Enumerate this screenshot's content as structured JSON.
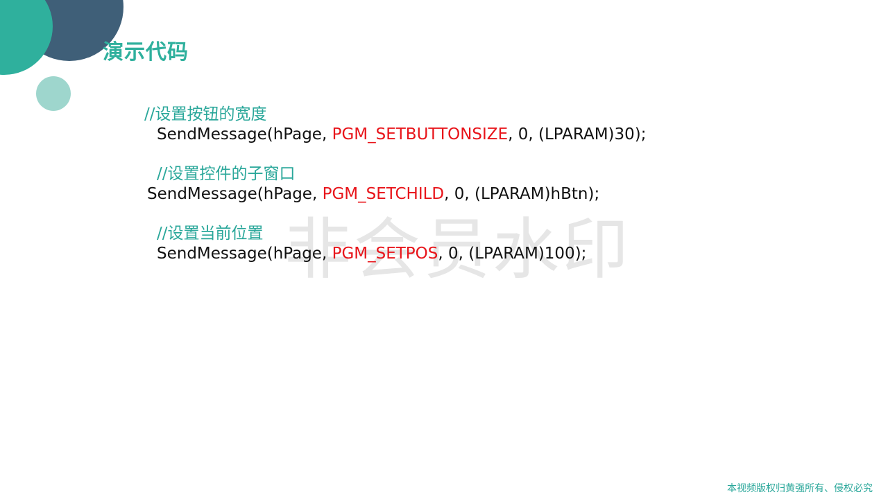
{
  "slide": {
    "title": "演示代码",
    "watermark": "非会员水印",
    "footer": "本视频版权归黄强所有、侵权必究"
  },
  "code_blocks": [
    {
      "comment": "//设置按钮的宽度",
      "call_prefix": "SendMessage(hPage, ",
      "constant": "PGM_SETBUTTONSIZE",
      "call_suffix": ", 0, (LPARAM)30);"
    },
    {
      "comment": "//设置控件的子窗口",
      "call_prefix": "SendMessage(hPage, ",
      "constant": "PGM_SETCHILD",
      "call_suffix": ", 0, (LPARAM)hBtn);"
    },
    {
      "comment": "//设置当前位置",
      "call_prefix": "SendMessage(hPage, ",
      "constant": "PGM_SETPOS",
      "call_suffix": ", 0, (LPARAM)100);"
    }
  ],
  "colors": {
    "title": "#2fb09d",
    "comment": "#2aa79a",
    "constant": "#e8141a",
    "code": "#111111",
    "circle_dark": "#3f5f78",
    "circle_teal": "#2fb09d",
    "circle_light": "#9ed6cd"
  }
}
